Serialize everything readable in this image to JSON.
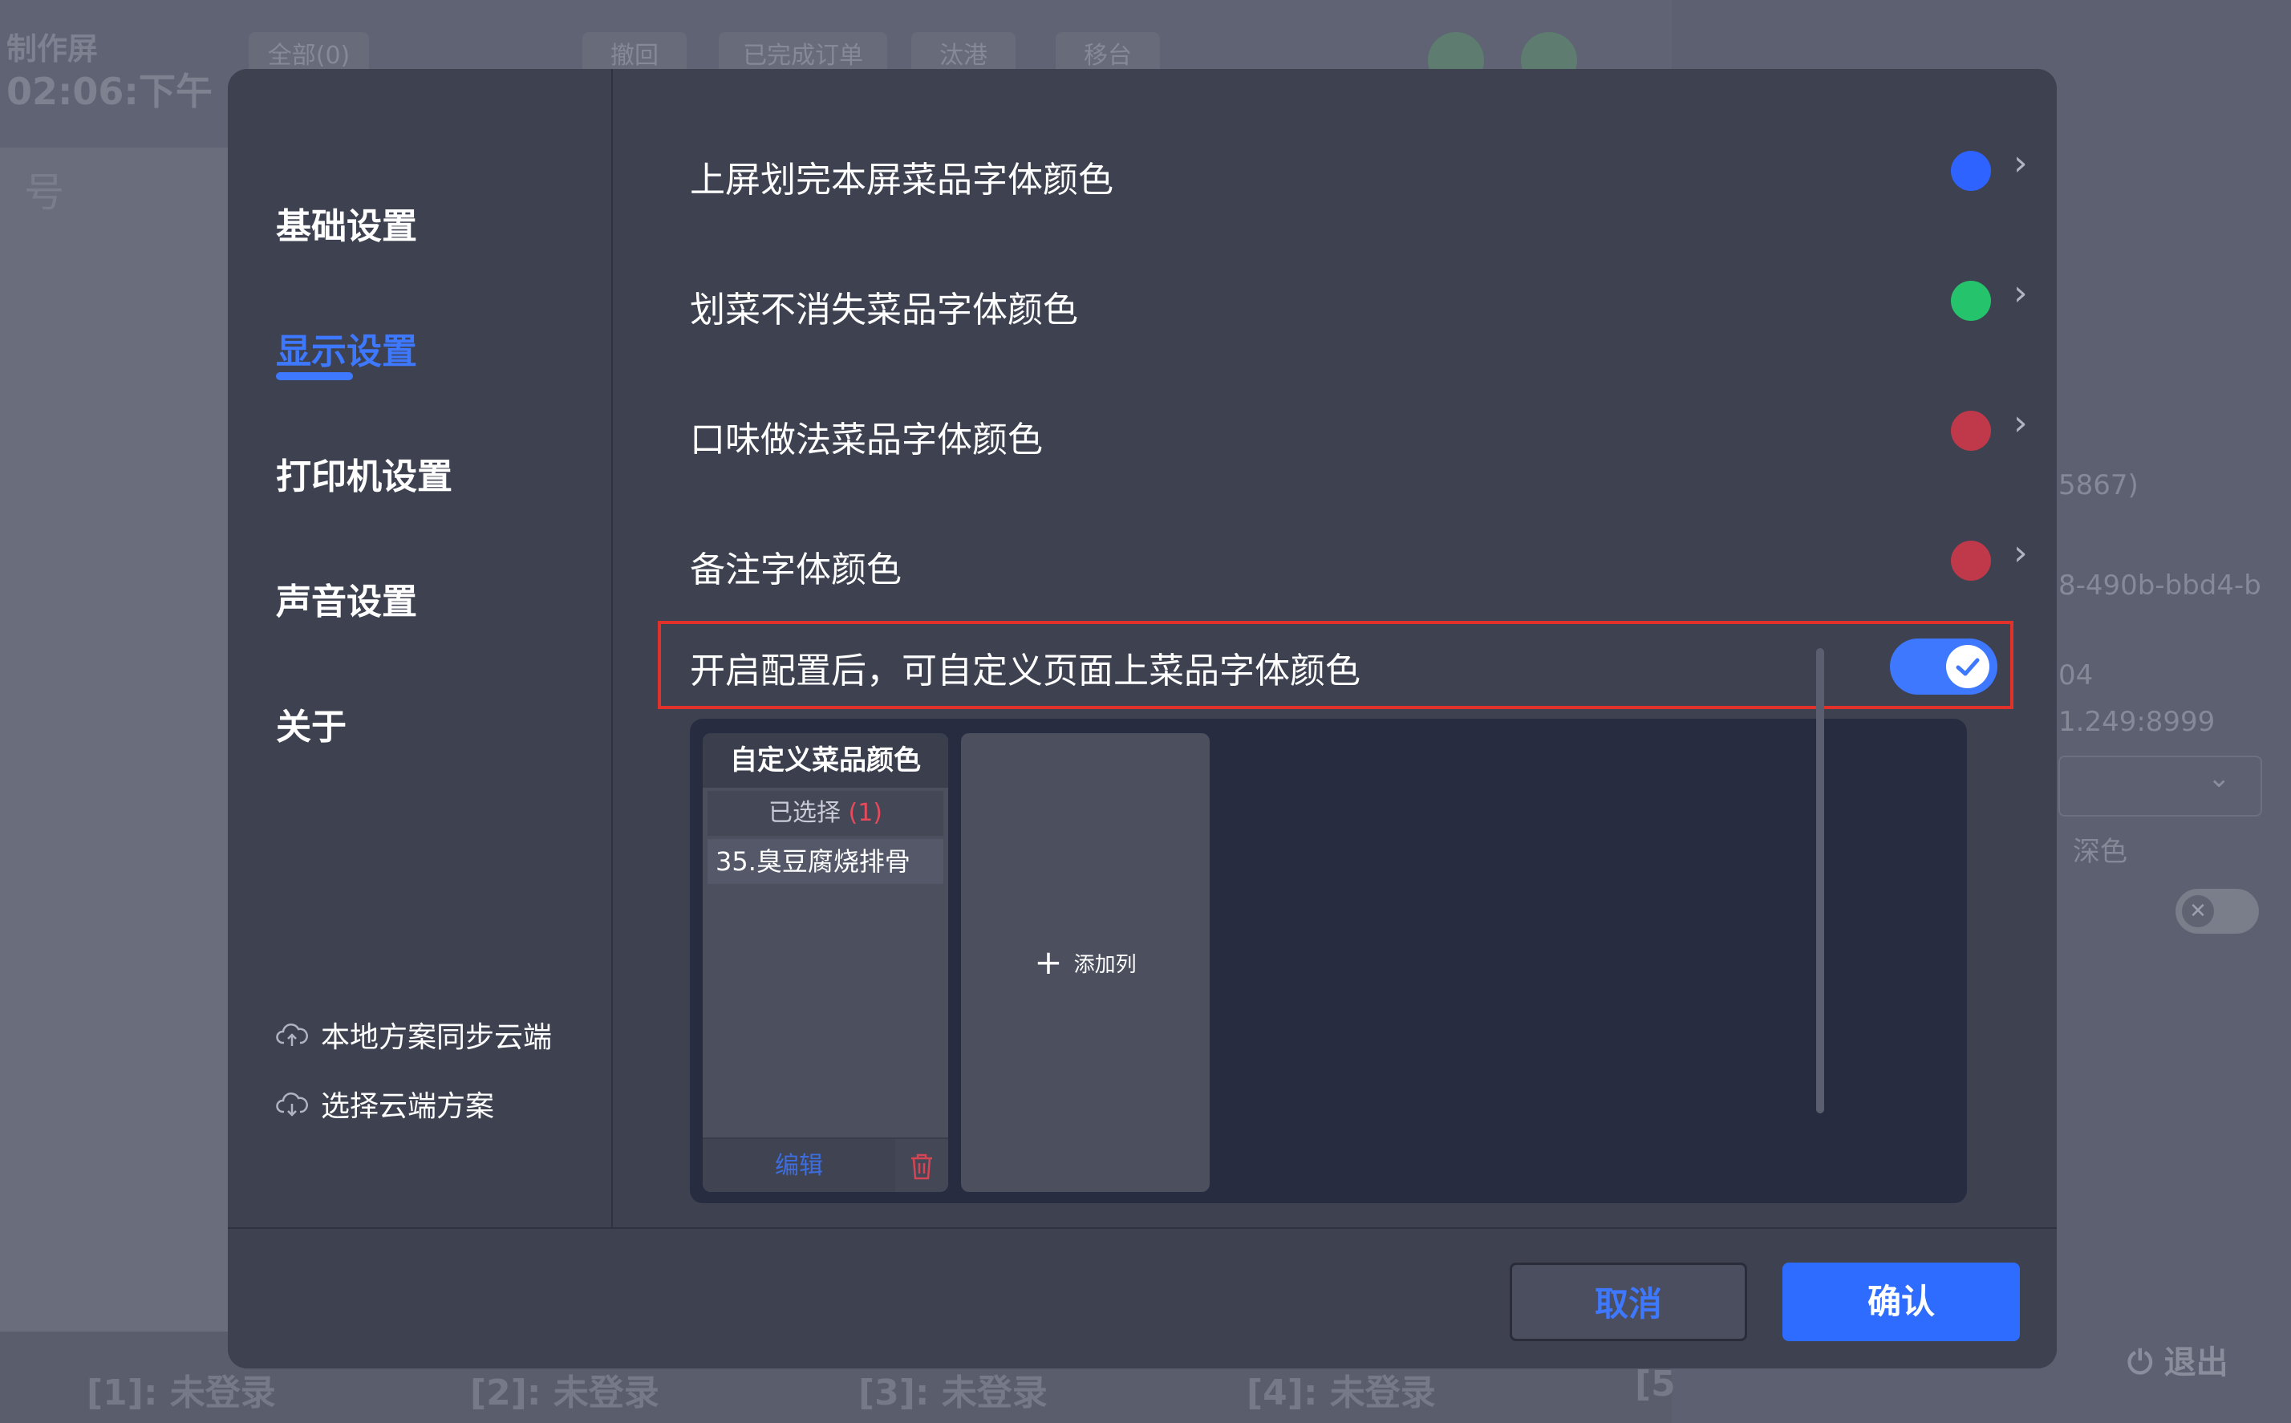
{
  "background": {
    "title": "制作屏",
    "clock": "02:06:下午",
    "left_label": "号",
    "toolbar": [
      "全部(0)",
      "撤回",
      "已完成订单",
      "汰港",
      "移台"
    ],
    "right_info": [
      "5867)",
      "8-490b-bbd4-b",
      "04",
      "1.249:8999",
      "深色"
    ],
    "exit_label": "退出",
    "logins": [
      "[1]: 未登录",
      "[2]: 未登录",
      "[3]: 未登录",
      "[4]: 未登录",
      "[5"
    ]
  },
  "sidebar": {
    "items": [
      {
        "label": "基础设置",
        "active": false
      },
      {
        "label": "显示设置",
        "active": true
      },
      {
        "label": "打印机设置",
        "active": false
      },
      {
        "label": "声音设置",
        "active": false
      },
      {
        "label": "关于",
        "active": false
      }
    ],
    "cloud_sync": "本地方案同步云端",
    "cloud_select": "选择云端方案"
  },
  "settings": [
    {
      "label": "上屏划完本屏菜品字体颜色",
      "color": "#2f63ff"
    },
    {
      "label": "划菜不消失菜品字体颜色",
      "color": "#24c36c"
    },
    {
      "label": "口味做法菜品字体颜色",
      "color": "#c0394a"
    },
    {
      "label": "备注字体颜色",
      "color": "#c0394a"
    }
  ],
  "custom_toggle": {
    "label": "开启配置后，可自定义页面上菜品字体颜色",
    "enabled": true
  },
  "custom_column": {
    "title": "自定义菜品颜色",
    "selected_label": "已选择",
    "selected_count": "(1)",
    "items": [
      "35.臭豆腐烧排骨"
    ],
    "edit_label": "编辑"
  },
  "add_column_label": "添加列",
  "buttons": {
    "cancel": "取消",
    "confirm": "确认"
  }
}
